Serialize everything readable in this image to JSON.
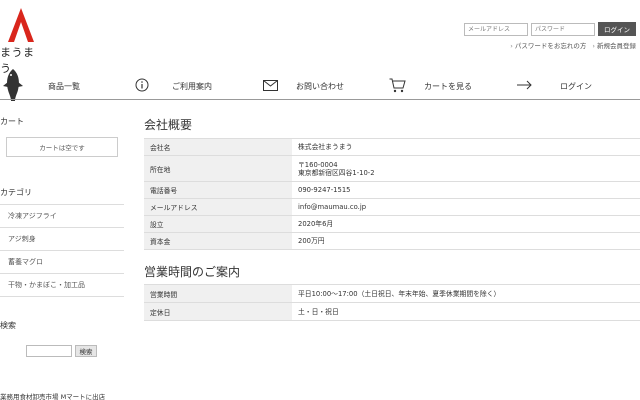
{
  "brand": {
    "name": "まうまう"
  },
  "login": {
    "email_placeholder": "メールアドレス",
    "password_placeholder": "パスワード",
    "button_label": "ログイン",
    "forgot_link": "パスワードをお忘れの方",
    "register_link": "新規会員登録"
  },
  "nav": {
    "items": [
      {
        "label": "商品一覧",
        "icon": "fish-icon"
      },
      {
        "label": "ご利用案内",
        "icon": "info-icon"
      },
      {
        "label": "お問い合わせ",
        "icon": "mail-icon"
      },
      {
        "label": "カートを見る",
        "icon": "cart-icon"
      },
      {
        "label": "ログイン",
        "icon": "arrow-right-icon"
      }
    ]
  },
  "sidebar": {
    "cart_heading": "カート",
    "cart_empty": "カートは空です",
    "category_heading": "カテゴリ",
    "categories": [
      "冷凍アジフライ",
      "アジ刺身",
      "蓄養マグロ",
      "干物・かまぼこ・加工品"
    ],
    "search_heading": "検索",
    "search_button": "検索",
    "shop_note": "業務用食材卸売市場 Mマートに出店"
  },
  "company": {
    "title": "会社概要",
    "rows": [
      {
        "k": "会社名",
        "v": [
          "株式会社まうまう"
        ]
      },
      {
        "k": "所在地",
        "v": [
          "〒160-0004",
          "東京都新宿区四谷1-10-2"
        ]
      },
      {
        "k": "電話番号",
        "v": [
          "090-9247-1515"
        ]
      },
      {
        "k": "メールアドレス",
        "v": [
          "info@maumau.co.jp"
        ]
      },
      {
        "k": "設立",
        "v": [
          "2020年6月"
        ]
      },
      {
        "k": "資本金",
        "v": [
          "200万円"
        ]
      }
    ]
  },
  "hours": {
    "title": "営業時間のご案内",
    "rows": [
      {
        "k": "営業時間",
        "v": [
          "平日10:00～17:00（土日祝日、年末年始、夏季休業期間を除く）"
        ]
      },
      {
        "k": "定休日",
        "v": [
          "土・日・祝日"
        ]
      }
    ]
  }
}
